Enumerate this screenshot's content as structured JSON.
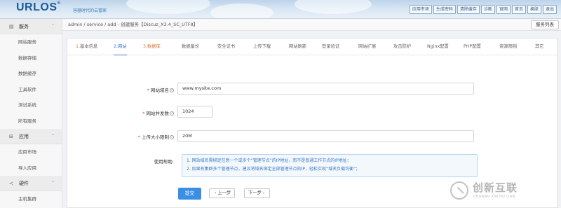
{
  "header": {
    "logo_text": "URLOS",
    "logo_mark": "®",
    "slogan": "容器时代的云管家",
    "nav": [
      "应用市场",
      "生成密码",
      "清除缓存",
      "诊断",
      "官网",
      "首页",
      "换肤",
      "退出"
    ]
  },
  "sidebar": {
    "sections": [
      {
        "label": "服务",
        "icon": "server-icon",
        "items": [
          "网站服务",
          "数据存储",
          "数据缓存",
          "工具软件",
          "测试系统",
          "所有服务"
        ]
      },
      {
        "label": "应用",
        "icon": "grid-icon",
        "items": [
          "应用市场",
          "导入应用"
        ]
      },
      {
        "label": "硬件",
        "icon": "share-icon",
        "items": [
          "主机集群"
        ]
      }
    ]
  },
  "breadcrumb": "admin / service / add - 创建服务【Discuz_X3.4_SC_UTF8】",
  "service_list_button": "服务列表",
  "tabs": [
    "1.基本信息",
    "2.网站",
    "3.数据库",
    "数据备份",
    "安全证书",
    "上传下载",
    "网站刷新",
    "登录验证",
    "网站扩展",
    "攻击防护",
    "Nginx配置",
    "PHP配置",
    "资源限制",
    "其它"
  ],
  "active_tab_index": 1,
  "form": {
    "domain_label": "网站域名",
    "domain_value": "www.mysite.com",
    "concurrency_label": "网站并发数",
    "concurrency_value": "1024",
    "upload_label": "上传大小限制",
    "upload_value": "20M",
    "help_label": "使用帮助:",
    "help_lines": [
      "1. 网站域名需绑定任意一个或多个“管理节点”的IP地址，而不是普通工作节点的IP地址；",
      "2. 如果有集群多个管理节点，建议将域名绑定全部管理节点的IP，轻松实现“域名负载均衡”；"
    ]
  },
  "buttons": {
    "submit": "提交",
    "prev": "上一步",
    "next": "下一步"
  },
  "watermark": {
    "cn": "创新互联",
    "en": "CHUANG XIN HU LIAN"
  },
  "colors": {
    "accent": "#3a7bd5",
    "submit": "#3a8ee6",
    "required": "#e03c3c",
    "brand": "#1c5a9b"
  }
}
